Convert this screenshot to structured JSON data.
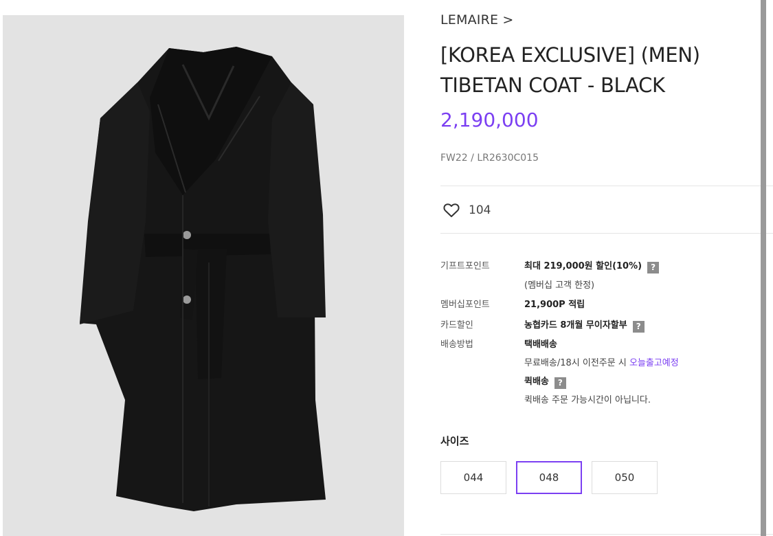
{
  "product": {
    "brand": "LEMAIRE >",
    "title_line1": "[KOREA EXCLUSIVE]  (MEN)",
    "title_line2": "TIBETAN COAT - BLACK",
    "price": "2,190,000",
    "sku": "FW22 / LR2630C015",
    "likes": "104"
  },
  "info": {
    "gift_point": {
      "label": "기프트포인트",
      "value": "최대 219,000원 할인(10%)",
      "note": "(멤버십 고객 한정)",
      "help": "?"
    },
    "membership_point": {
      "label": "멤버십포인트",
      "value": "21,900P 적립"
    },
    "card_discount": {
      "label": "카드할인",
      "value": "농협카드 8개월 무이자할부",
      "help": "?"
    },
    "shipping": {
      "label": "배송방법",
      "courier": "택배배송",
      "courier_note": "무료배송/18시 이전주문 시",
      "courier_link": "오늘출고예정",
      "quick": "퀵배송",
      "quick_help": "?",
      "quick_note": "퀵배송 주문 가능시간이 아닙니다."
    }
  },
  "size": {
    "label": "사이즈",
    "options": [
      "044",
      "048",
      "050"
    ],
    "selected": "048"
  },
  "colors": {
    "accent": "#7b3ff2",
    "image_bg": "#e3e3e3"
  },
  "icons": {
    "like": "heart-outline-icon",
    "help": "question-mark-icon"
  }
}
